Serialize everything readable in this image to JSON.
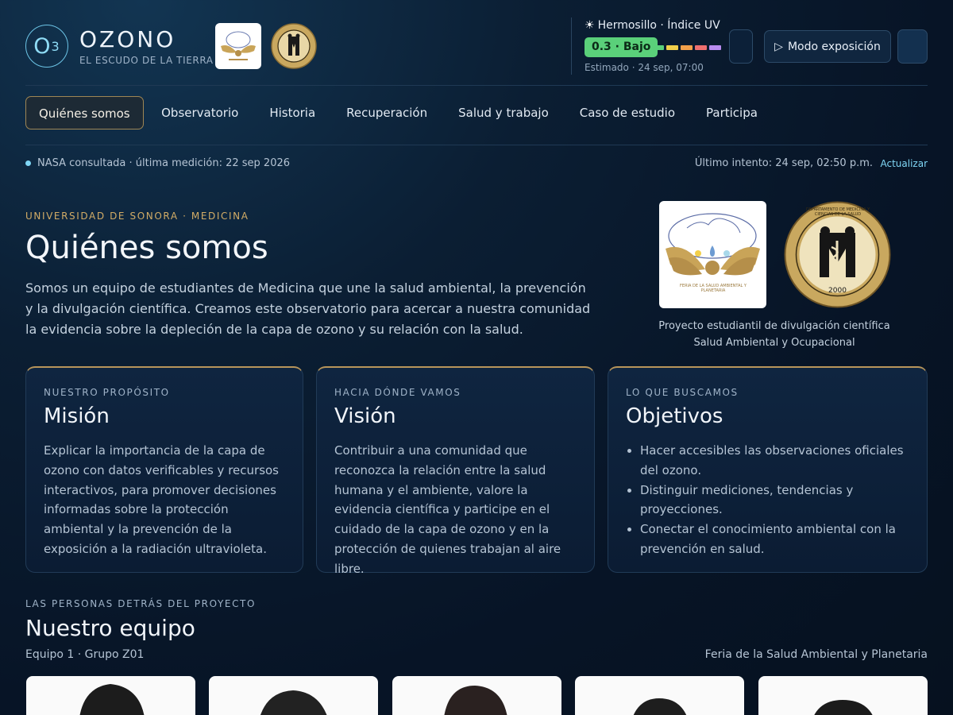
{
  "brand": {
    "logo_text": "O",
    "logo_sub": "3",
    "name": "OZONO",
    "tagline": "EL ESCUDO DE LA TIERRA"
  },
  "uv": {
    "title": "Hermosillo · Índice UV",
    "value_label": "0.3 · Bajo",
    "estimate": "Estimado · 24 sep, 07:00",
    "scale_colors": [
      "#5ad07a",
      "#f2cf4a",
      "#f2a04a",
      "#ee6f6f",
      "#b98cf0"
    ]
  },
  "header_actions": {
    "mode_label": "Modo exposición",
    "mode_icon": "play-icon"
  },
  "nav": [
    {
      "label": "Quiénes somos",
      "active": true
    },
    {
      "label": "Observatorio"
    },
    {
      "label": "Historia"
    },
    {
      "label": "Recuperación"
    },
    {
      "label": "Salud y trabajo"
    },
    {
      "label": "Caso de estudio"
    },
    {
      "label": "Participa"
    }
  ],
  "status": {
    "text": "NASA consultada · última medición: 22 sep 2026",
    "last_try": "Último intento: 24 sep, 02:50 p.m.",
    "refresh": "Actualizar"
  },
  "hero": {
    "eyebrow": "UNIVERSIDAD DE SONORA · MEDICINA",
    "title": "Quiénes somos",
    "text": "Somos un equipo de estudiantes de Medicina que une la salud ambiental, la prevención y la divulgación científica. Creamos este observatorio para acercar a nuestra comunidad la evidencia sobre la depleción de la capa de ozono y su relación con la salud.",
    "caption_1": "Proyecto estudiantil de divulgación científica",
    "caption_2": "Salud Ambiental y Ocupacional",
    "logo_1_text": "FERIA DE LA SALUD AMBIENTAL Y PLANETARIA",
    "logo_2_text": "DEPARTAMENTO DE MEDICINA Y CIENCIAS DE LA SALUD",
    "logo_2_year": "2000"
  },
  "cards": [
    {
      "eyebrow": "NUESTRO PROPÓSITO",
      "title": "Misión",
      "text": "Explicar la importancia de la capa de ozono con datos verificables y recursos interactivos, para promover decisiones informadas sobre la protección ambiental y la prevención de la exposición a la radiación ultravioleta."
    },
    {
      "eyebrow": "HACIA DÓNDE VAMOS",
      "title": "Visión",
      "text": "Contribuir a una comunidad que reconozca la relación entre la salud humana y el ambiente, valore la evidencia científica y participe en el cuidado de la capa de ozono y en la protección de quienes trabajan al aire libre."
    },
    {
      "eyebrow": "LO QUE BUSCAMOS",
      "title": "Objetivos",
      "items": [
        "Hacer accesibles las observaciones oficiales del ozono.",
        "Distinguir mediciones, tendencias y proyecciones.",
        "Conectar el conocimiento ambiental con la prevención en salud."
      ]
    }
  ],
  "team": {
    "eyebrow": "LAS PERSONAS DETRÁS DEL PROYECTO",
    "title": "Nuestro equipo",
    "subtitle": "Equipo 1 · Grupo Z01",
    "right": "Feria de la Salud Ambiental y Planetaria"
  }
}
